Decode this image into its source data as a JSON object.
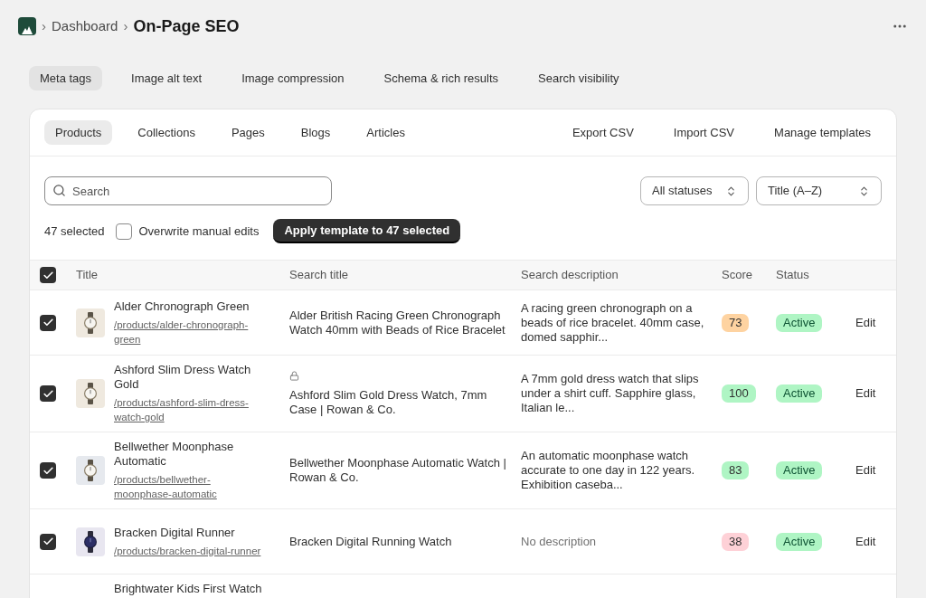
{
  "breadcrumb": {
    "parent": "Dashboard",
    "title": "On-Page SEO",
    "separator": "›"
  },
  "tabs": [
    {
      "label": "Meta tags",
      "selected": true
    },
    {
      "label": "Image alt text",
      "selected": false
    },
    {
      "label": "Image compression",
      "selected": false
    },
    {
      "label": "Schema & rich results",
      "selected": false
    },
    {
      "label": "Search visibility",
      "selected": false
    }
  ],
  "subtabs": [
    {
      "label": "Products",
      "selected": true
    },
    {
      "label": "Collections",
      "selected": false
    },
    {
      "label": "Pages",
      "selected": false
    },
    {
      "label": "Blogs",
      "selected": false
    },
    {
      "label": "Articles",
      "selected": false
    }
  ],
  "actions": [
    "Export CSV",
    "Import CSV",
    "Manage templates"
  ],
  "search": {
    "placeholder": "Search"
  },
  "filters": [
    {
      "value": "All statuses"
    },
    {
      "value": "Title (A–Z)"
    }
  ],
  "bulk": {
    "count": "47 selected",
    "overwrite": {
      "label": "Overwrite manual edits",
      "checked": false
    },
    "apply": "Apply template to 47 selected"
  },
  "table": {
    "all_checked": true,
    "columns": [
      "Title",
      "Search title",
      "Search description",
      "Score",
      "Status"
    ],
    "rows": [
      {
        "checked": true,
        "title": "Alder Chronograph Green",
        "url": "/products/alder-chronograph-green",
        "search_title": "Alder British Racing Green Chronograph Watch 40mm with Beads of Rice Bracelet",
        "locked": false,
        "description": "A racing green chronograph on a beads of rice bracelet. 40mm case, domed sapphir...",
        "missing": false,
        "score": "73",
        "color": "#fed3a1",
        "status": "Active",
        "edit": "Edit"
      },
      {
        "checked": true,
        "title": "Ashford Slim Dress Watch Gold",
        "url": "/products/ashford-slim-dress-watch-gold",
        "search_title": "Ashford Slim Gold Dress Watch, 7mm Case | Rowan & Co.",
        "locked": true,
        "description": "A 7mm gold dress watch that slips under a shirt cuff. Sapphire glass, Italian le...",
        "missing": false,
        "score": "100",
        "color": "#aff5c4",
        "status": "Active",
        "edit": "Edit"
      },
      {
        "checked": true,
        "title": "Bellwether Moonphase Automatic",
        "url": "/products/bellwether-moonphase-automatic",
        "search_title": "Bellwether Moonphase Automatic Watch | Rowan & Co.",
        "locked": false,
        "description": "An automatic moonphase watch accurate to one day in 122 years. Exhibition caseba...",
        "missing": false,
        "score": "83",
        "color": "#aff5c4",
        "status": "Active",
        "edit": "Edit"
      },
      {
        "checked": true,
        "title": "Bracken Digital Runner",
        "url": "/products/bracken-digital-runner",
        "search_title": "Bracken Digital Running Watch",
        "locked": false,
        "description": "No description",
        "missing": true,
        "score": "38",
        "color": "#fed1d7",
        "status": "Active",
        "edit": "Edit"
      }
    ],
    "partial_row": {
      "title": "Brightwater Kids First Watch"
    }
  }
}
